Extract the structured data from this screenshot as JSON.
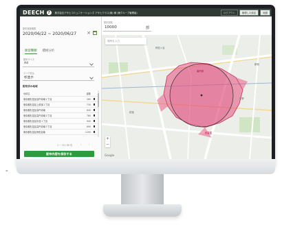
{
  "app": {
    "logo": "DEECH",
    "company": "株式会社アサヒコミュニケーションズ アサヒクラス(案) 様 (東グループ管理者)",
    "links": [
      "ログアウト",
      "管理した設定",
      "地図"
    ]
  },
  "panel": {
    "date_label": "配布実施期間",
    "date_range": "2020/06/22 ~ 2020/06/27",
    "date_clear": "×",
    "tabs": [
      "販促種類",
      "積極分析"
    ],
    "size_label": "配布サイズ",
    "size_value": "A4",
    "area_label": "エリア絞込",
    "area_value": "杉並ホ",
    "section_title": "配布済み地域",
    "table": {
      "headers": [
        "地域名",
        "部数"
      ],
      "rows": [
        {
          "name": "東京都杉並区高円寺南１丁目",
          "count": "260"
        },
        {
          "name": "東京都杉並区上荻窪１丁目",
          "count": "730"
        },
        {
          "name": "東京都杉並区高円寺南",
          "count": "640"
        },
        {
          "name": "東京都杉並区高円寺南２丁目",
          "count": "780"
        },
        {
          "name": "東京都杉並区杉並１丁目",
          "count": "940"
        },
        {
          "name": "東京都杉並区高円寺南３丁目",
          "count": "690"
        },
        {
          "name": "東京都杉並区阿佐谷南",
          "count": "1290"
        }
      ]
    },
    "paging": {
      "text": "1 ~ 20 / 89 件",
      "prev": "‹",
      "next": "›"
    },
    "cta_label": "配布内容を保存する"
  },
  "map": {
    "amount_label": "配布部数",
    "amount_value": "10000",
    "amount_unit": "部",
    "search_placeholder": "場所を入力",
    "labels": [
      "阿佐ヶ谷",
      "高円寺",
      "中野",
      "荻窪",
      "新宿",
      "杉並区"
    ],
    "google": "Google",
    "zoom_in": "+",
    "zoom_out": "−"
  },
  "colors": {
    "brand_green": "#2f9a3e",
    "topbar": "#2f3a35",
    "polygon": "#e7507f",
    "radius_circle": "#d9477a"
  }
}
